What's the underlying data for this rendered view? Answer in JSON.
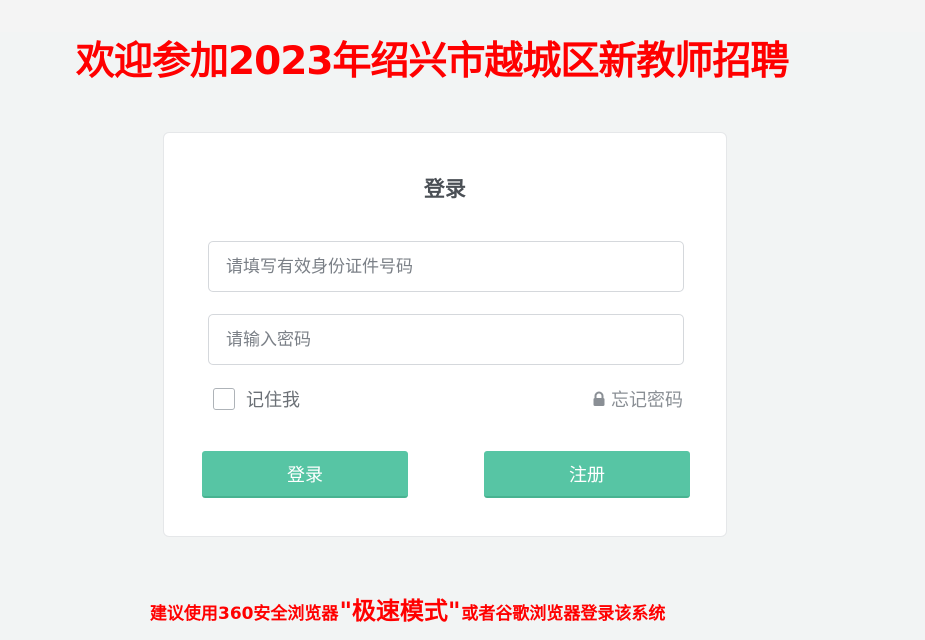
{
  "header": {
    "welcome_title": "欢迎参加2023年绍兴市越城区新教师招聘"
  },
  "login": {
    "title": "登录",
    "id_placeholder": "请填写有效身份证件号码",
    "password_placeholder": "请输入密码",
    "remember_label": "记住我",
    "forgot_label": "忘记密码",
    "login_button": "登录",
    "register_button": "注册"
  },
  "footer": {
    "tip_before": "建议使用360安全浏览器",
    "tip_emphasis": "\"极速模式\"",
    "tip_after": "或者谷歌浏览器登录该系统"
  },
  "icons": {
    "lock": "lock-icon"
  },
  "colors": {
    "title_red": "#ff0000",
    "button_green": "#57c5a4"
  }
}
